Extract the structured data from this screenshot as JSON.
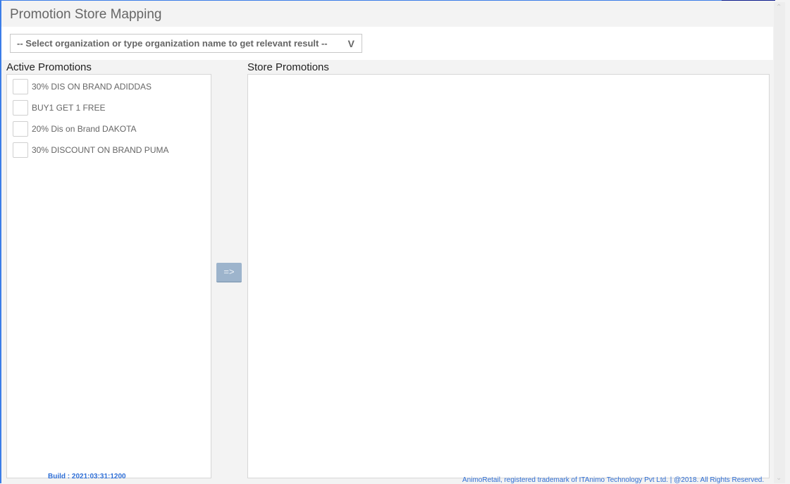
{
  "title": "Promotion Store Mapping",
  "organization_select": {
    "placeholder": "-- Select organization or type organization name to get relevant result --",
    "arrow": "V"
  },
  "active_promotions": {
    "label": "Active Promotions",
    "items": [
      {
        "label": "30% DIS ON BRAND ADIDDAS",
        "checked": false
      },
      {
        "label": "BUY1 GET 1 FREE",
        "checked": false
      },
      {
        "label": "20% Dis on Brand DAKOTA",
        "checked": false
      },
      {
        "label": "30% DISCOUNT ON BRAND PUMA",
        "checked": false
      }
    ]
  },
  "move_button": "=>",
  "store_promotions": {
    "label": "Store Promotions",
    "items": []
  },
  "footer": {
    "build": "Build : 2021:03:31:1200",
    "copyright": "AnimoRetail, registered trademark of ITAnimo Technology Pvt Ltd. | @2018. All Rights Reserved."
  }
}
